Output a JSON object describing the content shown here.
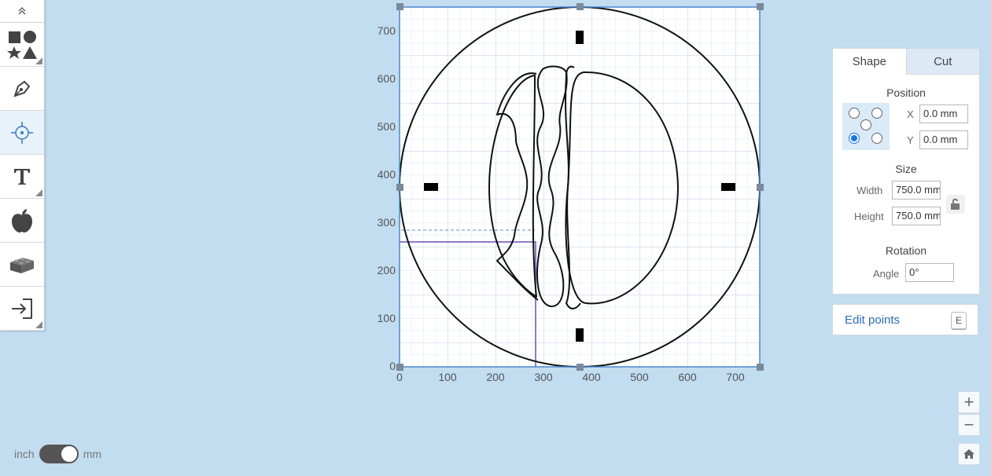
{
  "toolbar": {
    "collapse_icon": "double-chevron-up-icon",
    "tools": [
      {
        "name": "shapes",
        "icon": "shapes-icon"
      },
      {
        "name": "pen",
        "icon": "pen-nib-icon"
      },
      {
        "name": "center",
        "icon": "crosshair-icon",
        "active": true
      },
      {
        "name": "text",
        "icon": "text-T-icon"
      },
      {
        "name": "library",
        "icon": "apple-icon"
      },
      {
        "name": "projects",
        "icon": "lego-brick-icon"
      },
      {
        "name": "import",
        "icon": "import-arrow-icon"
      }
    ]
  },
  "canvas": {
    "x_ticks": [
      "0",
      "100",
      "200",
      "300",
      "400",
      "500",
      "600",
      "700"
    ],
    "y_ticks": [
      "0",
      "100",
      "200",
      "300",
      "400",
      "500",
      "600",
      "700"
    ],
    "selection_color": "#4a86c8",
    "guide_color": "#6a4fb5"
  },
  "panel": {
    "tabs": [
      "Shape",
      "Cut"
    ],
    "active_tab": "Shape",
    "position": {
      "title": "Position",
      "x_label": "X",
      "x_value": "0.0 mm",
      "y_label": "Y",
      "y_value": "0.0 mm",
      "anchor_selected": "bottom-left"
    },
    "size": {
      "title": "Size",
      "width_label": "Width",
      "width_value": "750.0 mm",
      "height_label": "Height",
      "height_value": "750.0 mm",
      "lock_icon": "unlock-icon"
    },
    "rotation": {
      "title": "Rotation",
      "angle_label": "Angle",
      "angle_value": "0°"
    }
  },
  "edit_points": {
    "label": "Edit points",
    "shortcut": "E"
  },
  "zoom": {
    "in": "+",
    "out": "−",
    "home_icon": "home-icon"
  },
  "units": {
    "left": "inch",
    "right": "mm",
    "selected": "mm"
  }
}
